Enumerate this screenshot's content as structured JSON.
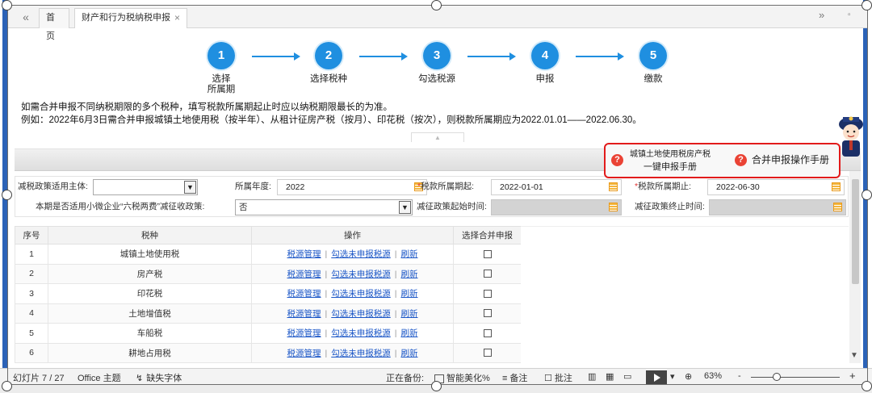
{
  "tabs": {
    "back": "«",
    "home": "首页",
    "active": "财产和行为税纳税申报",
    "close": "×",
    "forward": "»",
    "restore": "▫"
  },
  "steps": [
    {
      "num": "1",
      "label": "选择\n所属期"
    },
    {
      "num": "2",
      "label": "选择税种"
    },
    {
      "num": "3",
      "label": "勾选税源"
    },
    {
      "num": "4",
      "label": "申报"
    },
    {
      "num": "5",
      "label": "缴款"
    }
  ],
  "notes": {
    "line1": "如需合并申报不同纳税期限的多个税种，填写税款所属期起止时应以纳税期限最长的为准。",
    "line2": "例如：2022年6月3日需合并申报城镇土地使用税（按半年）、从租计征房产税（按月）、印花税（按次），则税款所属期应为2022.01.01——2022.06.30。"
  },
  "manuals": {
    "one_click_line1": "城镇土地使用税房产税",
    "one_click_line2": "一键申报手册",
    "merge": "合并申报操作手册",
    "icon_glyph": "?"
  },
  "form": {
    "subject_label": "减税政策适用主体:",
    "subject_value": "",
    "year_label": "所属年度:",
    "year_value": "2022",
    "period_start_label": "税款所属期起:",
    "period_start_value": "2022-01-01",
    "period_end_label": "税款所属期止:",
    "period_end_value": "2022-06-30",
    "six_tax_label": "本期是否适用小微企业“六税两费”减征收政策:",
    "six_tax_value": "否",
    "policy_start_label": "减征政策起始时间:",
    "policy_end_label": "减征政策终止时间:",
    "required_mark": "*",
    "dropdown_glyph": "▼"
  },
  "table": {
    "headers": [
      "序号",
      "税种",
      "操作",
      "选择合并申报"
    ],
    "action_links": [
      "税源管理",
      "勾选未申报税源",
      "刷新"
    ],
    "action_sep": "|",
    "rows": [
      {
        "no": "1",
        "name": "城镇土地使用税"
      },
      {
        "no": "2",
        "name": "房产税"
      },
      {
        "no": "3",
        "name": "印花税"
      },
      {
        "no": "4",
        "name": "土地增值税"
      },
      {
        "no": "5",
        "name": "车船税"
      },
      {
        "no": "6",
        "name": "耕地占用税"
      }
    ]
  },
  "statusbar": {
    "slide": "幻灯片 7 / 27",
    "theme": "Office 主题",
    "missing_font": "缺失字体",
    "backup": "正在备份:",
    "beautify": "智能美化%",
    "notes": "备注",
    "annotate": "批注",
    "zoom": "63%",
    "minus": "-",
    "plus": "+"
  },
  "colors": {
    "accent": "#1f8fe0",
    "highlight": "#e21b1b",
    "link": "#1a56c7"
  }
}
